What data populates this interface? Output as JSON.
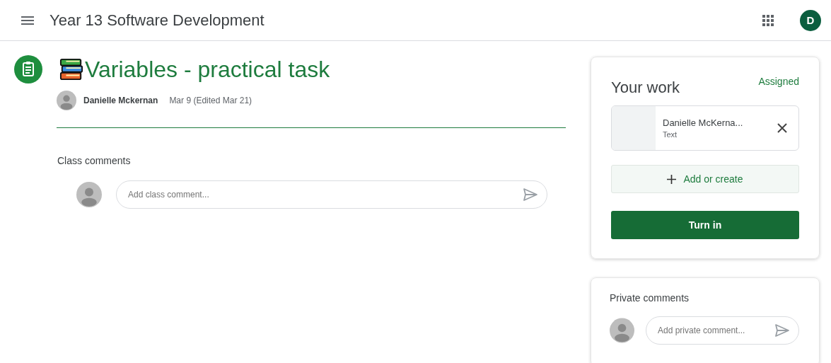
{
  "header": {
    "class_name": "Year 13 Software Development",
    "account_initial": "D"
  },
  "assignment": {
    "title": "Variables - practical task",
    "author": "Danielle Mckernan",
    "date": "Mar 9 (Edited Mar 21)"
  },
  "class_comments": {
    "heading": "Class comments",
    "placeholder": "Add class comment..."
  },
  "your_work": {
    "title": "Your work",
    "status": "Assigned",
    "attachments": [
      {
        "name": "Danielle McKerna...",
        "type": "Text"
      }
    ],
    "add_label": "Add or create",
    "turn_in_label": "Turn in"
  },
  "private_comments": {
    "heading": "Private comments",
    "placeholder": "Add private comment..."
  }
}
